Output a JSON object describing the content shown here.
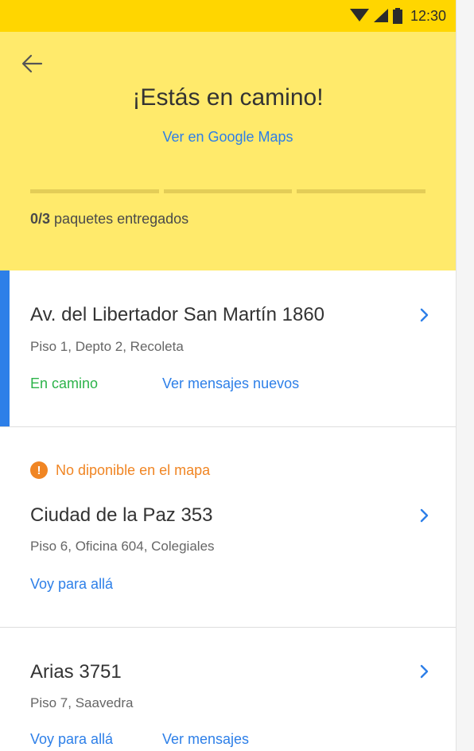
{
  "status_bar": {
    "time": "12:30"
  },
  "header": {
    "title": "¡Estás en camino!",
    "maps_link": "Ver en Google Maps",
    "progress": {
      "delivered": "0/3",
      "label": "paquetes entregados",
      "segments_filled": 0,
      "segments_total": 3
    }
  },
  "deliveries": [
    {
      "address": "Av. del Libertador San Martín 1860",
      "detail": "Piso 1, Depto 2, Recoleta",
      "status": "En camino",
      "action": "Ver mensajes nuevos"
    },
    {
      "warning": "No diponible en el mapa",
      "address": "Ciudad de la Paz 353",
      "detail": "Piso 6, Oficina 604, Colegiales",
      "action": "Voy para allá"
    },
    {
      "address": "Arias 3751",
      "detail": "Piso 7, Saavedra",
      "action": "Voy para allá",
      "action2": "Ver mensajes"
    }
  ],
  "colors": {
    "accent": "#2d7fe8",
    "header_bg": "#ffea6b",
    "status_bar_bg": "#ffd600",
    "warning": "#f08523",
    "success": "#2cb34a"
  }
}
